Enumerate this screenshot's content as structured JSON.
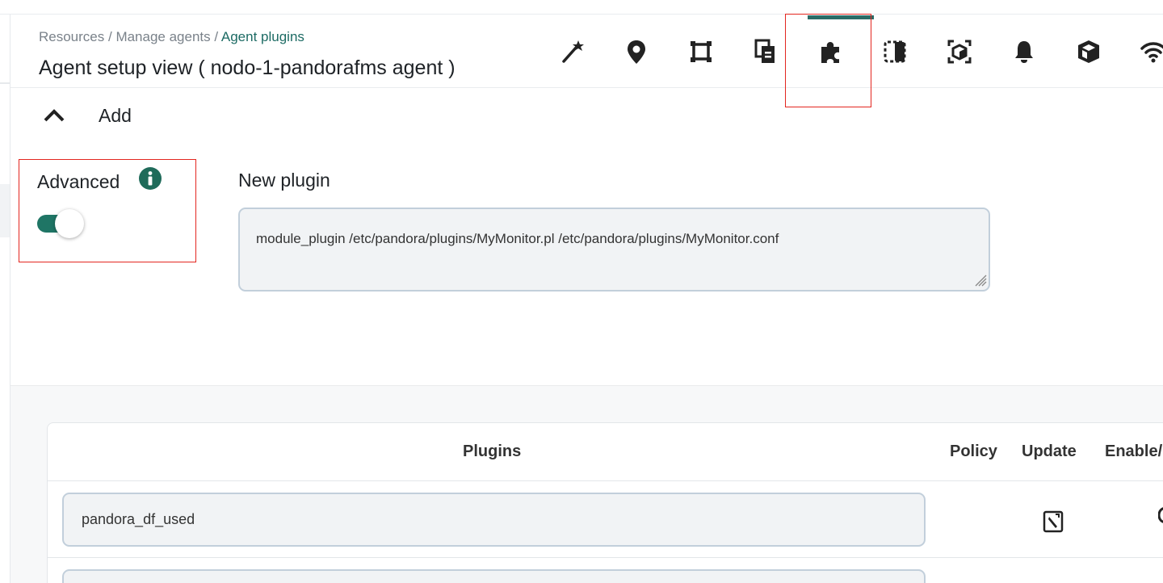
{
  "breadcrumb": {
    "items": [
      "Resources",
      "Manage agents"
    ],
    "separator": " / ",
    "current": "Agent plugins"
  },
  "header": {
    "title": "Agent setup view ( nodo-1-pandorafms agent )",
    "tabs": [
      {
        "icon": "magic-wand-icon",
        "active": false
      },
      {
        "icon": "map-pin-icon",
        "active": false
      },
      {
        "icon": "module-frame-icon",
        "active": false
      },
      {
        "icon": "copy-icon",
        "active": false
      },
      {
        "icon": "puzzle-icon",
        "active": true
      },
      {
        "icon": "split-panel-icon",
        "active": false
      },
      {
        "icon": "scan-cube-icon",
        "active": false
      },
      {
        "icon": "bell-icon",
        "active": false
      },
      {
        "icon": "cube-icon",
        "active": false
      },
      {
        "icon": "wifi-icon",
        "active": false
      }
    ]
  },
  "add_section": {
    "label": "Add",
    "expanded": true
  },
  "advanced": {
    "label": "Advanced",
    "enabled": true
  },
  "new_plugin": {
    "label": "New plugin",
    "value": "module_plugin /etc/pandora/plugins/MyMonitor.pl /etc/pandora/plugins/MyMonitor.conf"
  },
  "table": {
    "headers": {
      "plugins": "Plugins",
      "policy": "Policy",
      "update": "Update",
      "enable": "Enable/"
    },
    "rows": [
      {
        "plugin": "pandora_df_used",
        "policy": ""
      },
      {
        "plugin": "",
        "policy": ""
      }
    ]
  },
  "colors": {
    "accent": "#2b6b66",
    "toggle_on": "#1f7565",
    "highlight_box": "#e3261f",
    "link": "#1d6b64"
  }
}
